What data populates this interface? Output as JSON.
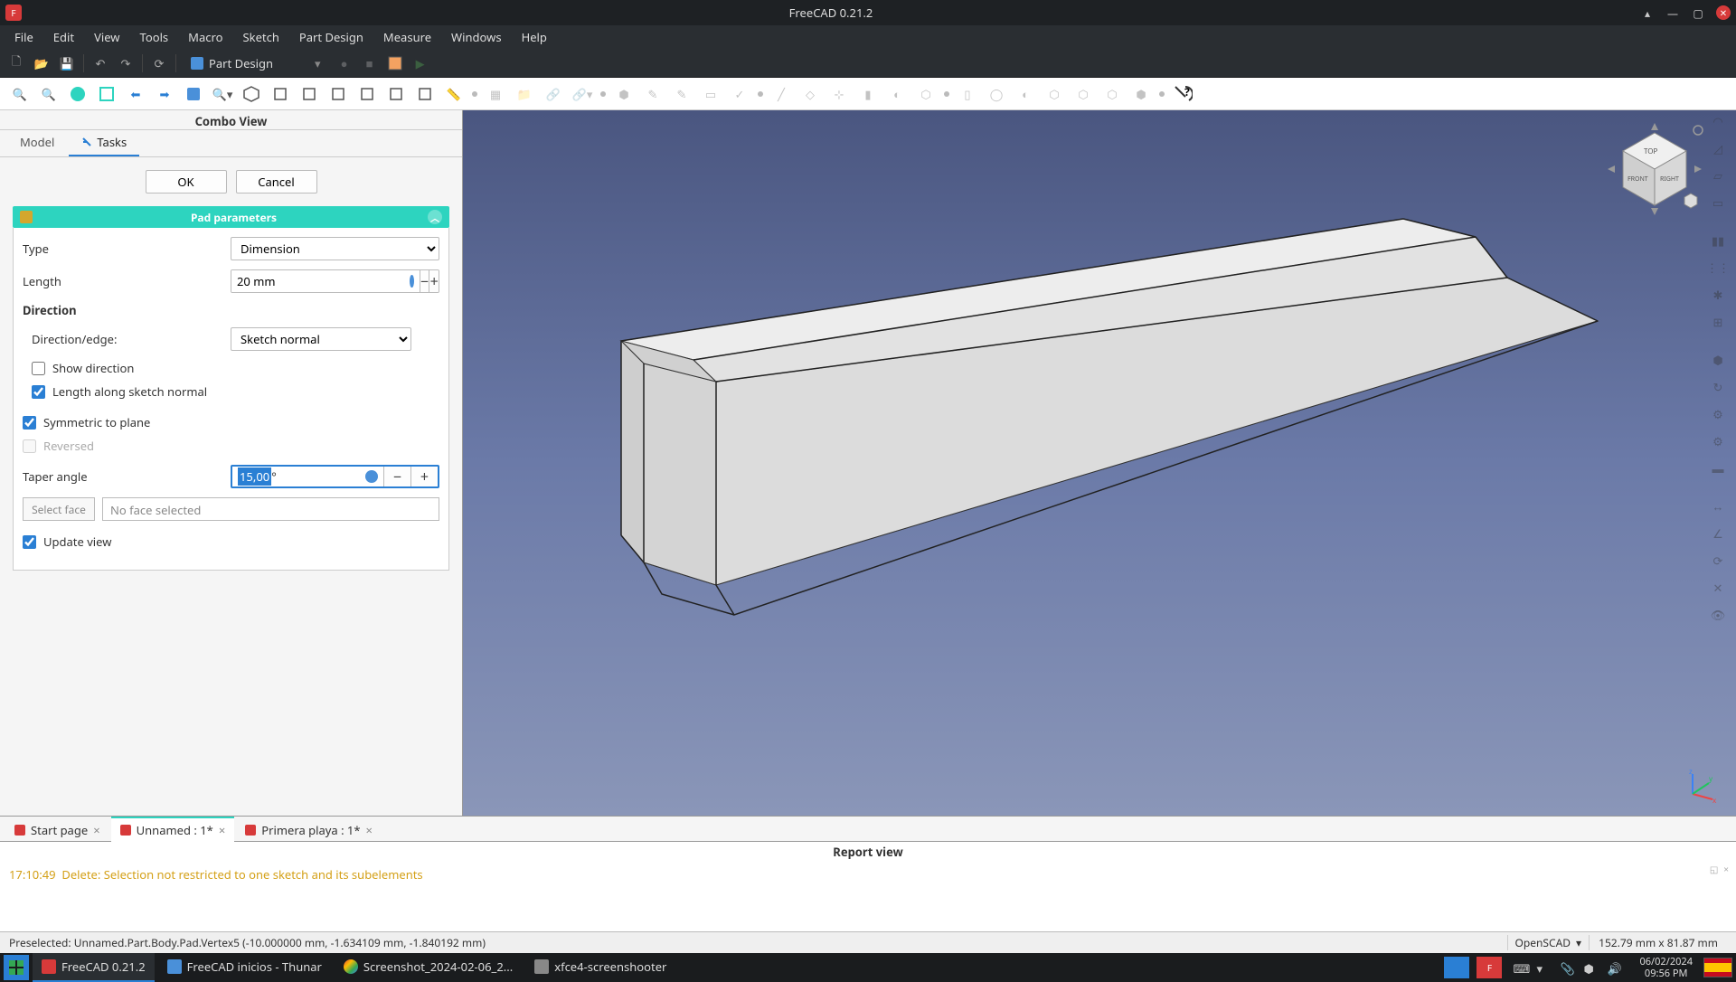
{
  "titlebar": {
    "title": "FreeCAD 0.21.2"
  },
  "menubar": [
    "File",
    "Edit",
    "View",
    "Tools",
    "Macro",
    "Sketch",
    "Part Design",
    "Measure",
    "Windows",
    "Help"
  ],
  "toolbar1": {
    "workbench": "Part Design"
  },
  "combo": {
    "title": "Combo View",
    "tabs": {
      "model": "Model",
      "tasks": "Tasks"
    },
    "buttons": {
      "ok": "OK",
      "cancel": "Cancel"
    },
    "section_title": "Pad parameters",
    "params": {
      "type_label": "Type",
      "type_value": "Dimension",
      "length_label": "Length",
      "length_value": "20 mm",
      "direction_heading": "Direction",
      "direction_edge_label": "Direction/edge:",
      "direction_edge_value": "Sketch normal",
      "show_direction": "Show direction",
      "length_along": "Length along sketch normal",
      "symmetric": "Symmetric to plane",
      "reversed": "Reversed",
      "taper_label": "Taper angle",
      "taper_value_sel": "15,00",
      "taper_unit": " °",
      "select_face_btn": "Select face",
      "no_face": "No face selected",
      "update_view": "Update view"
    }
  },
  "doc_tabs": {
    "items": [
      {
        "label": "Start page"
      },
      {
        "label": "Unnamed : 1*"
      },
      {
        "label": "Primera playa : 1*"
      }
    ]
  },
  "report": {
    "title": "Report view",
    "log_time": "17:10:49",
    "log_msg": "Delete: Selection not restricted to one sketch and its subelements"
  },
  "statusbar": {
    "preselected": "Preselected: Unnamed.Part.Body.Pad.Vertex5 (-10.000000 mm, -1.634109 mm, -1.840192 mm)",
    "backend": "OpenSCAD",
    "dimensions": "152.79 mm x 81.87 mm"
  },
  "taskbar": {
    "items": [
      {
        "label": "FreeCAD 0.21.2"
      },
      {
        "label": "FreeCAD inicios - Thunar"
      },
      {
        "label": "Screenshot_2024-02-06_2..."
      },
      {
        "label": "xfce4-screenshooter"
      }
    ],
    "date": "06/02/2024",
    "time": "09:56 PM"
  }
}
